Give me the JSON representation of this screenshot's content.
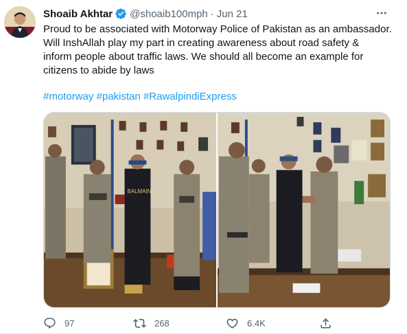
{
  "tweet": {
    "author_name": "Shoaib Akhtar",
    "handle": "@shoaib100mph",
    "separator": "·",
    "date": "Jun 21",
    "text_lines": [
      "Proud to be associated with Motorway Police of Pakistan as an ambassador.",
      "Will InshAllah play my part in creating awareness about road safety &",
      "inform people about traffic laws. We should all become an example for",
      "citizens to abide by laws"
    ],
    "hashtags": [
      "#motorway",
      "#pakistan",
      "#RawalpindiExpress"
    ],
    "photos": [
      {
        "subject": "Handing over a shield at a desk"
      },
      {
        "subject": "Group handshake in an office"
      }
    ],
    "photo_sign_text": "BALMAIN"
  },
  "actions": {
    "reply_count": "97",
    "retweet_count": "268",
    "like_count": "6.4K",
    "icons": [
      "reply-icon",
      "retweet-icon",
      "like-icon",
      "share-icon"
    ]
  },
  "colors": {
    "link": "#1d9bf0",
    "secondary_text": "#536471",
    "verified": "#1d9bf0"
  }
}
